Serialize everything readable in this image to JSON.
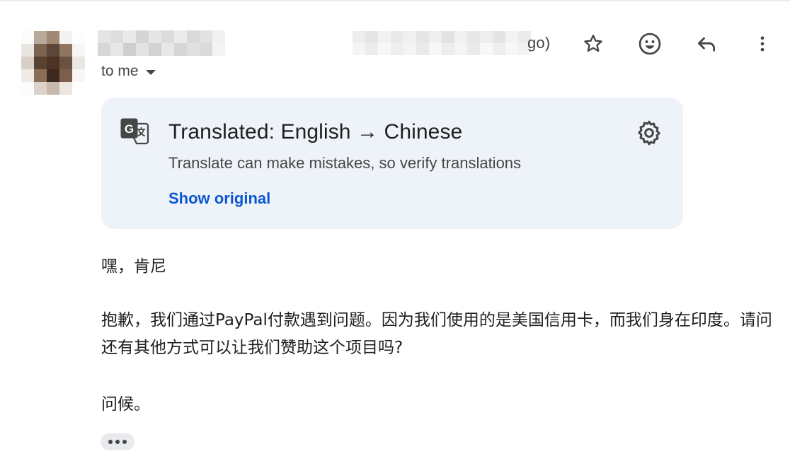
{
  "header": {
    "date_suffix": "go)",
    "recipient_label": "to me"
  },
  "actions": {
    "star": "star-icon",
    "react": "emoji-icon",
    "reply": "reply-icon",
    "more": "more-vert-icon"
  },
  "translation": {
    "title": "Translated: English → Chinese",
    "subtitle": "Translate can make mistakes, so verify translations",
    "show_original": "Show original"
  },
  "message": {
    "greeting": "嘿，肯尼",
    "paragraph": "抱歉，我们通过PayPal付款遇到问题。因为我们使用的是美国信用卡，而我们身在印度。请问还有其他方式可以让我们赞助这个项目吗?",
    "closing": "问候。"
  },
  "colors": {
    "card_background": "#eef2f9",
    "link": "#0b57d0",
    "icon": "#444746"
  }
}
